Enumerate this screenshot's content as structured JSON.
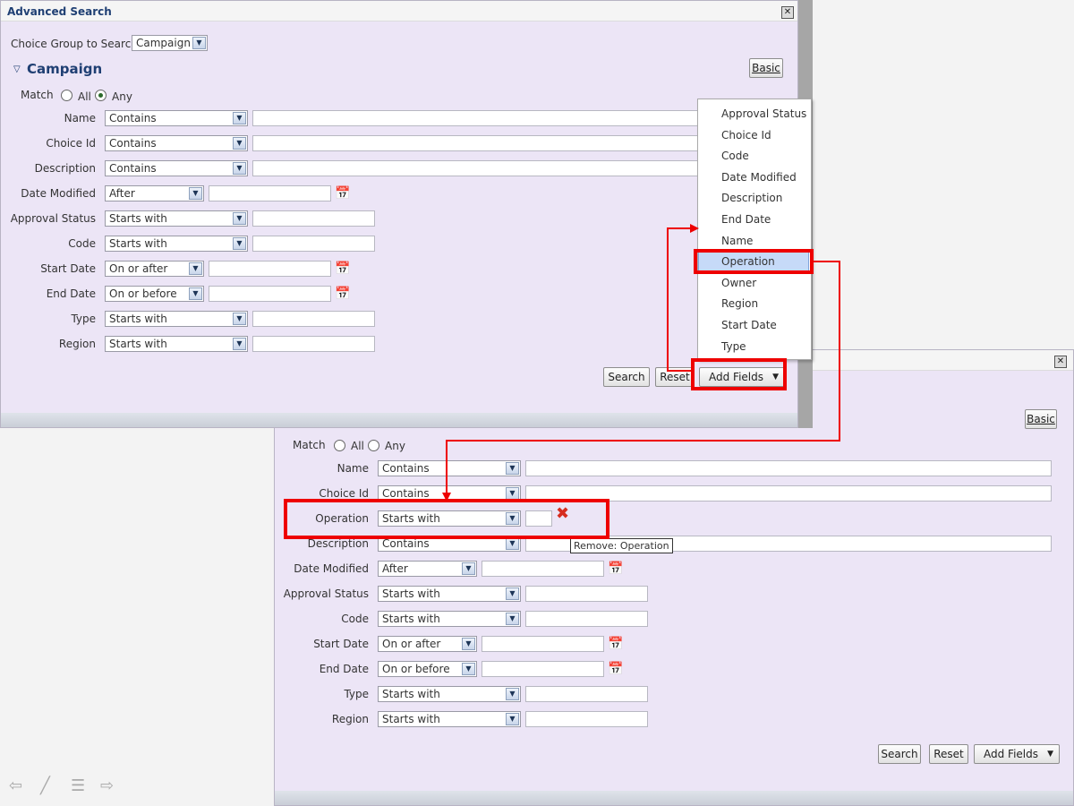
{
  "dialog1": {
    "title": "Advanced Search",
    "choice_group_label": "Choice Group to Search",
    "choice_group_value": "Campaign",
    "section_title": "Campaign",
    "basic_label": "Basic",
    "match_label": "Match",
    "match_all": "All",
    "match_any": "Any",
    "rows": [
      {
        "label": "Name",
        "operator": "Contains"
      },
      {
        "label": "Choice Id",
        "operator": "Contains"
      },
      {
        "label": "Description",
        "operator": "Contains"
      },
      {
        "label": "Date Modified",
        "operator": "After"
      },
      {
        "label": "Approval Status",
        "operator": "Starts with"
      },
      {
        "label": "Code",
        "operator": "Starts with"
      },
      {
        "label": "Start Date",
        "operator": "On or after"
      },
      {
        "label": "End Date",
        "operator": "On or before"
      },
      {
        "label": "Type",
        "operator": "Starts with"
      },
      {
        "label": "Region",
        "operator": "Starts with"
      }
    ],
    "search_label": "Search",
    "reset_label": "Reset",
    "add_fields_label": "Add Fields"
  },
  "menu": {
    "items": [
      "Approval Status",
      "Choice Id",
      "Code",
      "Date Modified",
      "Description",
      "End Date",
      "Name",
      "Operation",
      "Owner",
      "Region",
      "Start Date",
      "Type"
    ],
    "selected": "Operation"
  },
  "dialog2": {
    "basic_label": "Basic",
    "match_label": "Match",
    "match_all": "All",
    "match_any": "Any",
    "rows": [
      {
        "label": "Name",
        "operator": "Contains"
      },
      {
        "label": "Choice Id",
        "operator": "Contains"
      },
      {
        "label": "Operation",
        "operator": "Starts with"
      },
      {
        "label": "Description",
        "operator": "Contains"
      },
      {
        "label": "Date Modified",
        "operator": "After"
      },
      {
        "label": "Approval Status",
        "operator": "Starts with"
      },
      {
        "label": "Code",
        "operator": "Starts with"
      },
      {
        "label": "Start Date",
        "operator": "On or after"
      },
      {
        "label": "End Date",
        "operator": "On or before"
      },
      {
        "label": "Type",
        "operator": "Starts with"
      },
      {
        "label": "Region",
        "operator": "Starts with"
      }
    ],
    "tooltip": "Remove: Operation",
    "search_label": "Search",
    "reset_label": "Reset",
    "add_fields_label": "Add Fields"
  },
  "icons": {
    "close": "close-icon",
    "calendar": "calendar-icon",
    "remove": "remove-x-icon",
    "dropdown": "chevron-down-icon",
    "collapse": "collapse-chevron-icon",
    "nav": [
      "back-arrow-icon",
      "pen-icon",
      "menu-icon",
      "forward-arrow-icon"
    ]
  },
  "colors": {
    "dialog_bg": "#ece5f6",
    "highlight": "#ee0000",
    "title_text": "#1f3f73",
    "menu_selected": "#c6daf8"
  }
}
